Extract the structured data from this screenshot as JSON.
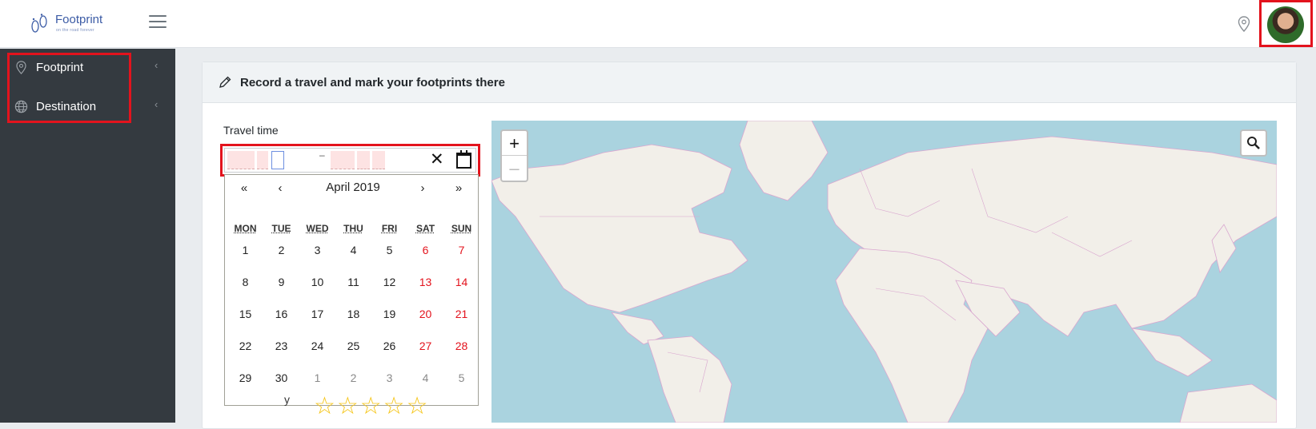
{
  "brand": {
    "name": "Footprint",
    "tagline": "on the road forever"
  },
  "sidebar": {
    "items": [
      {
        "label": "Footprint",
        "icon": "location-pin-icon"
      },
      {
        "label": "Destination",
        "icon": "globe-icon"
      }
    ]
  },
  "card": {
    "title": "Record a travel and mark your footprints there"
  },
  "travel_time": {
    "label": "Travel time",
    "separator": "–"
  },
  "calendar": {
    "nav": {
      "prev_year": "«",
      "prev_month": "‹",
      "next_month": "›",
      "next_year": "»"
    },
    "month_label": "April 2019",
    "weekdays": [
      "MON",
      "TUE",
      "WED",
      "THU",
      "FRI",
      "SAT",
      "SUN"
    ],
    "weeks": [
      [
        "1",
        "2",
        "3",
        "4",
        "5",
        "6",
        "7"
      ],
      [
        "8",
        "9",
        "10",
        "11",
        "12",
        "13",
        "14"
      ],
      [
        "15",
        "16",
        "17",
        "18",
        "19",
        "20",
        "21"
      ],
      [
        "22",
        "23",
        "24",
        "25",
        "26",
        "27",
        "28"
      ],
      [
        "29",
        "30",
        "1",
        "2",
        "3",
        "4",
        "5"
      ]
    ]
  },
  "rating": {
    "label": "y",
    "stars": "☆☆☆☆☆"
  },
  "map": {
    "zoom_in": "+",
    "zoom_out": "–"
  },
  "colors": {
    "highlight": "#e3131d",
    "sidebar_bg": "#343a40",
    "map_water": "#aad3df",
    "map_land": "#f2efe9"
  }
}
